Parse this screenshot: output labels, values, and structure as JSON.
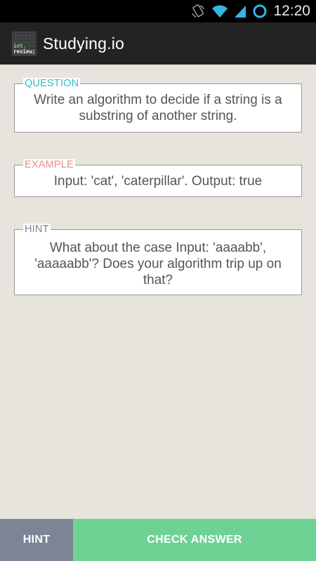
{
  "status_bar": {
    "time": "12:20",
    "icons": [
      "rotate-icon",
      "wifi-icon",
      "signal-icon",
      "alarm-ring-icon"
    ]
  },
  "action_bar": {
    "logo_lines": [
      "int.",
      "review;"
    ],
    "title": "Studying.io"
  },
  "cards": {
    "question": {
      "label": "QUESTION",
      "text": "Write an algorithm to decide if a string is a substring of another string."
    },
    "example": {
      "label": "EXAMPLE",
      "text": "Input: 'cat', 'caterpillar'. Output: true"
    },
    "hint": {
      "label": "HINT",
      "text": "What about the case Input: 'aaaabb', 'aaaaabb'? Does your algorithm trip up on that?"
    }
  },
  "buttons": {
    "hint_label": "HINT",
    "check_label": "CHECK ANSWER"
  },
  "colors": {
    "background": "#e7e3dd",
    "action_bar": "#232323",
    "question_label": "#2fbfc8",
    "example_label": "#f08a86",
    "hint_label": "#7d8694",
    "hint_button": "#7d8495",
    "check_button": "#6ed294"
  }
}
